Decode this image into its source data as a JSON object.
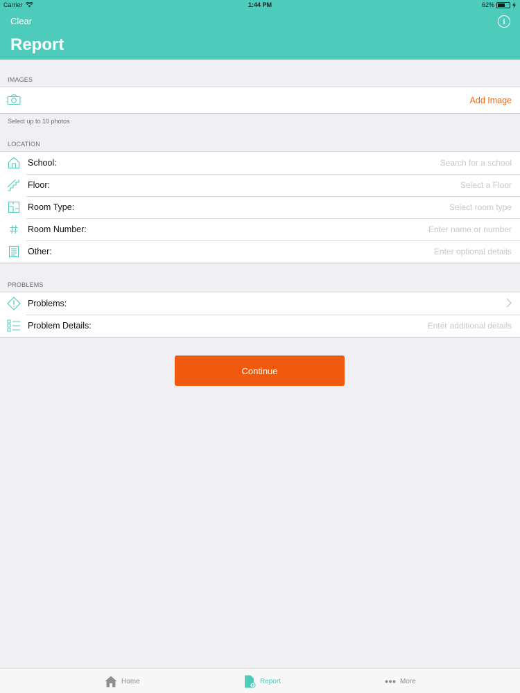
{
  "status_bar": {
    "carrier": "Carrier",
    "time": "1:44 PM",
    "battery": "62%",
    "battery_level": 0.62
  },
  "header": {
    "clear_label": "Clear",
    "info_label": "i",
    "title": "Report",
    "color": "#4dcbbb"
  },
  "images": {
    "section_title": "IMAGES",
    "camera_icon": "camera-icon",
    "add_label": "Add Image",
    "footer": "Select up to 10 photos"
  },
  "location": {
    "section_title": "LOCATION",
    "rows": [
      {
        "icon": "school-icon",
        "label": "School:",
        "placeholder": "Search for a school"
      },
      {
        "icon": "stairs-icon",
        "label": "Floor:",
        "placeholder": "Select a Floor"
      },
      {
        "icon": "room-type-icon",
        "label": "Room Type:",
        "placeholder": "Select room type"
      },
      {
        "icon": "hash-icon",
        "label": "Room Number:",
        "placeholder": "Enter name or number"
      },
      {
        "icon": "notes-icon",
        "label": "Other:",
        "placeholder": "Enter optional details"
      }
    ]
  },
  "problems": {
    "section_title": "PROBLEMS",
    "rows": [
      {
        "icon": "warning-icon",
        "label": "Problems:",
        "placeholder": ""
      },
      {
        "icon": "checklist-icon",
        "label": "Problem Details:",
        "placeholder": "Enter additional details"
      }
    ]
  },
  "continue_label": "Continue",
  "accent_color": "#f05a0e",
  "tabs": [
    {
      "icon": "home-icon",
      "label": "Home",
      "active": false
    },
    {
      "icon": "report-icon",
      "label": "Report",
      "active": true
    },
    {
      "icon": "more-icon",
      "label": "More",
      "active": false
    }
  ]
}
